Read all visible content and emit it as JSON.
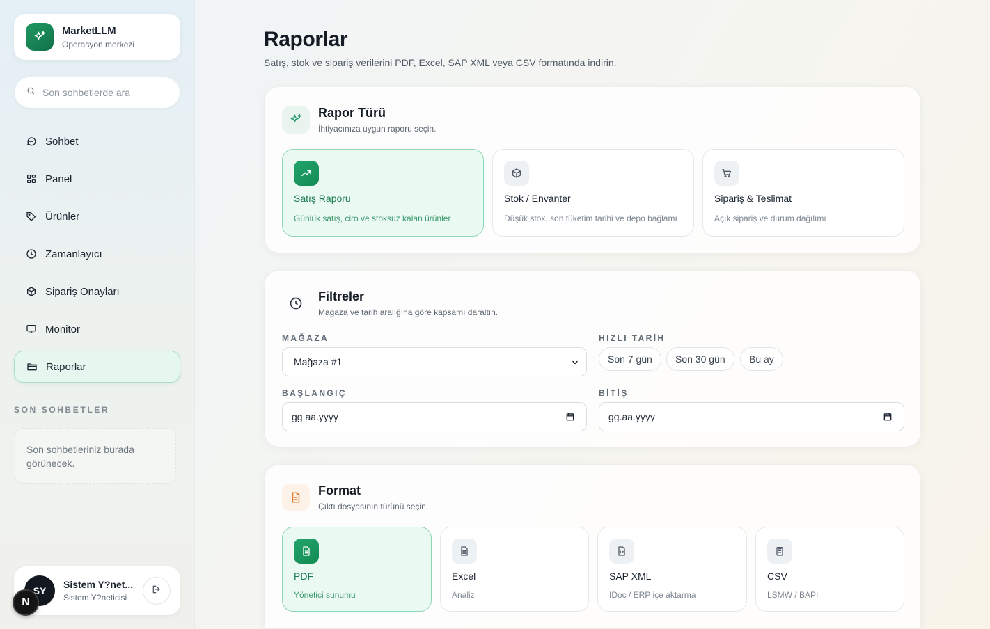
{
  "brand": {
    "name": "MarketLLM",
    "subtitle": "Operasyon merkezi"
  },
  "search": {
    "placeholder": "Son sohbetlerde ara"
  },
  "nav": [
    {
      "label": "Sohbet",
      "icon": "chat-icon"
    },
    {
      "label": "Panel",
      "icon": "grid-icon"
    },
    {
      "label": "Ürünler",
      "icon": "tag-icon"
    },
    {
      "label": "Zamanlayıcı",
      "icon": "clock-icon"
    },
    {
      "label": "Sipariş Onayları",
      "icon": "box-icon"
    },
    {
      "label": "Monitor",
      "icon": "monitor-icon"
    },
    {
      "label": "Raporlar",
      "icon": "folder-icon",
      "active": true
    }
  ],
  "recent": {
    "section_label": "SON SOHBETLER",
    "empty_text": "Son sohbetleriniz burada görünecek."
  },
  "user": {
    "initials": "SY",
    "name": "Sistem Y?net...",
    "role": "Sistem Y?neticisi",
    "badge": "N"
  },
  "page": {
    "title": "Raporlar",
    "subtitle": "Satış, stok ve sipariş verilerini PDF, Excel, SAP XML veya CSV formatında indirin."
  },
  "report_type": {
    "title": "Rapor Türü",
    "subtitle": "İhtiyacınıza uygun raporu seçin.",
    "options": [
      {
        "title": "Satış Raporu",
        "desc": "Günlük satış, ciro ve stoksuz kalan ürünler",
        "icon": "trend-up-icon",
        "selected": true
      },
      {
        "title": "Stok / Envanter",
        "desc": "Düşük stok, son tüketim tarihi ve depo bağlamı",
        "icon": "package-icon",
        "selected": false
      },
      {
        "title": "Sipariş & Teslimat",
        "desc": "Açık sipariş ve durum dağılımı",
        "icon": "cart-icon",
        "selected": false
      }
    ]
  },
  "filters": {
    "title": "Filtreler",
    "subtitle": "Mağaza ve tarih aralığına göre kapsamı daraltın.",
    "store_label": "MAĞAZA",
    "store_value": "Mağaza #1",
    "quick_label": "HIZLI TARİH",
    "quick": [
      "Son 7 gün",
      "Son 30 gün",
      "Bu ay"
    ],
    "start_label": "BAŞLANGIÇ",
    "start_value": "gg.aa.yyyy",
    "end_label": "BİTİŞ",
    "end_value": "gg.aa.yyyy"
  },
  "format": {
    "title": "Format",
    "subtitle": "Çıktı dosyasının türünü seçin.",
    "options": [
      {
        "title": "PDF",
        "desc": "Yönetici sunumu",
        "icon": "file-text-icon",
        "selected": true
      },
      {
        "title": "Excel",
        "desc": "Analiz",
        "icon": "spreadsheet-icon",
        "selected": false
      },
      {
        "title": "SAP XML",
        "desc": "IDoc / ERP içe aktarma",
        "icon": "file-code-icon",
        "selected": false
      },
      {
        "title": "CSV",
        "desc": "LSMW / BAPI",
        "icon": "clipboard-icon",
        "selected": false
      }
    ]
  },
  "colors": {
    "accent": "#1f9a64",
    "accent_light": "#eaf9f1",
    "orange": "#e07a2b"
  }
}
